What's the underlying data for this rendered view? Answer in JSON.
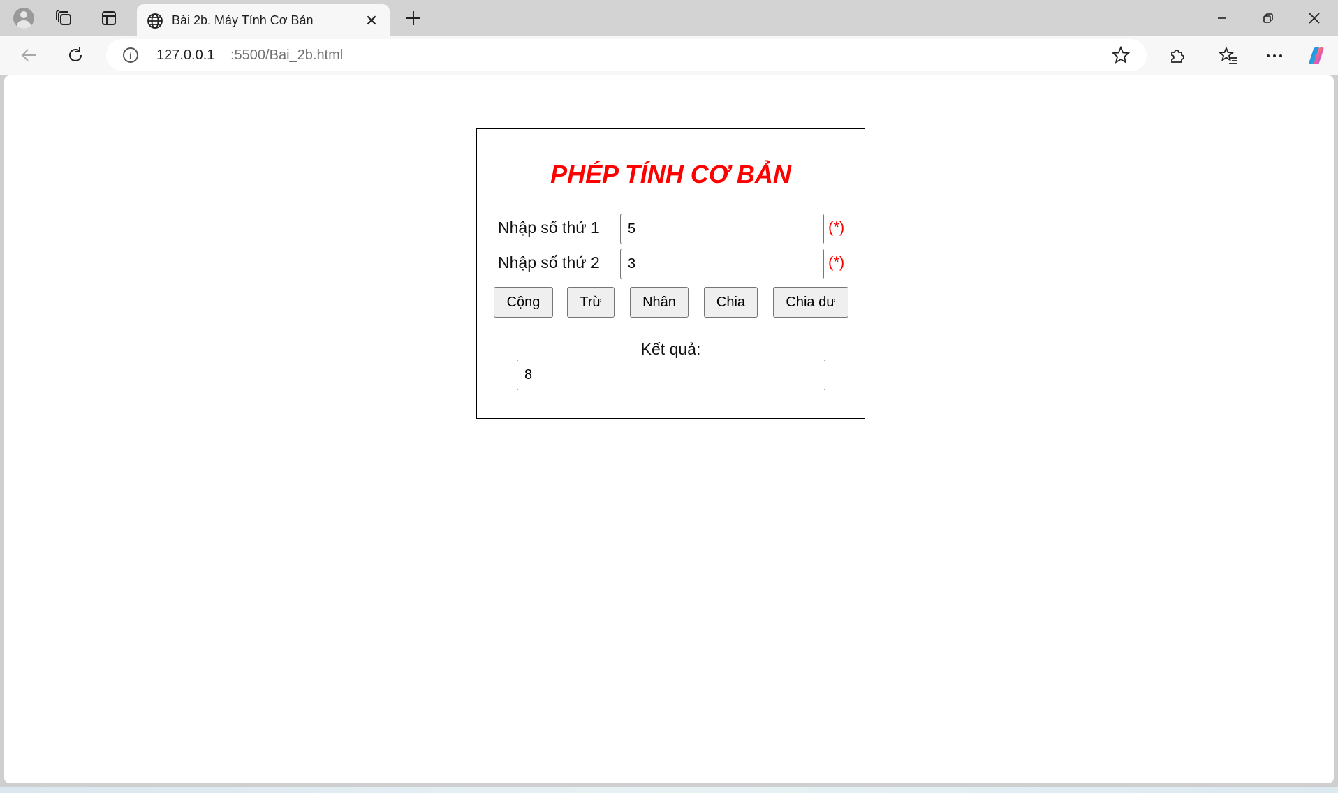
{
  "browser": {
    "tab_title": "Bài 2b. Máy Tính Cơ Bản",
    "url_host": "127.0.0.1",
    "url_path": ":5500/Bai_2b.html",
    "icons": [
      "profile-icon",
      "collections-icon",
      "tab-actions-icon",
      "globe-icon",
      "close-icon",
      "plus-icon",
      "minimize-icon",
      "restore-icon",
      "back-icon",
      "reload-icon",
      "info-icon",
      "star-icon",
      "extensions-icon",
      "favorites-icon",
      "more-icon",
      "copilot-icon"
    ]
  },
  "calculator": {
    "title": "PHÉP TÍNH CƠ BẢN",
    "input1_label": "Nhập số thứ 1",
    "input1_value": "5",
    "input2_label": "Nhập số thứ 2",
    "input2_value": "3",
    "required_mark": "(*)",
    "buttons": [
      "Cộng",
      "Trừ",
      "Nhân",
      "Chia",
      "Chia dư"
    ],
    "result_label": "Kết quả:",
    "result_value": "8"
  },
  "colors": {
    "title": "#ff0000",
    "required": "#ff0000",
    "button_bg": "#efefef"
  }
}
